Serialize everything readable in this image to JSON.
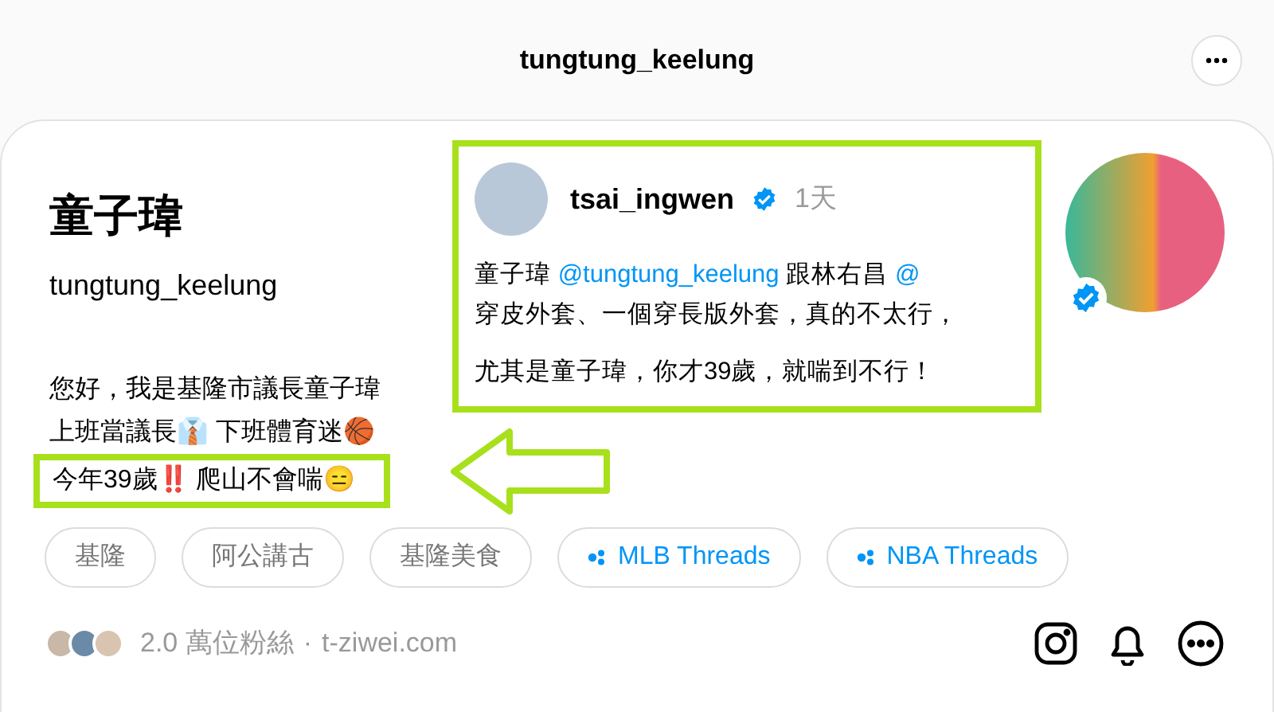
{
  "header": {
    "title": "tungtung_keelung"
  },
  "profile": {
    "name": "童子瑋",
    "handle": "tungtung_keelung",
    "verified": true,
    "bio": [
      {
        "text": "您好，我是基隆市議長童子瑋",
        "highlighted": false
      },
      {
        "text": "上班當議長👔 下班體育迷🏀",
        "highlighted": false
      },
      {
        "text": "今年39歲‼️ 爬山不會喘😑",
        "highlighted": true
      }
    ],
    "tags": [
      {
        "label": "基隆",
        "kind": "plain"
      },
      {
        "label": "阿公講古",
        "kind": "plain"
      },
      {
        "label": "基隆美食",
        "kind": "plain"
      },
      {
        "label": "MLB Threads",
        "kind": "community"
      },
      {
        "label": "NBA Threads",
        "kind": "community"
      }
    ],
    "followers": "2.0 萬位粉絲",
    "separator": "·",
    "link": "t-ziwei.com"
  },
  "post": {
    "user": "tsai_ingwen",
    "verified": true,
    "time": "1天",
    "lines": [
      [
        {
          "text": "童子瑋 ",
          "kind": "plain"
        },
        {
          "text": "@tungtung_keelung",
          "kind": "mention"
        },
        {
          "text": " 跟林右昌 ",
          "kind": "plain"
        },
        {
          "text": "@",
          "kind": "mention"
        }
      ],
      [
        {
          "text": "穿皮外套、一個穿長版外套，真的不太行，",
          "kind": "plain"
        }
      ],
      [
        {
          "text": "尤其是童子瑋，你才39歲，就喘到不行！",
          "kind": "plain"
        }
      ]
    ]
  }
}
